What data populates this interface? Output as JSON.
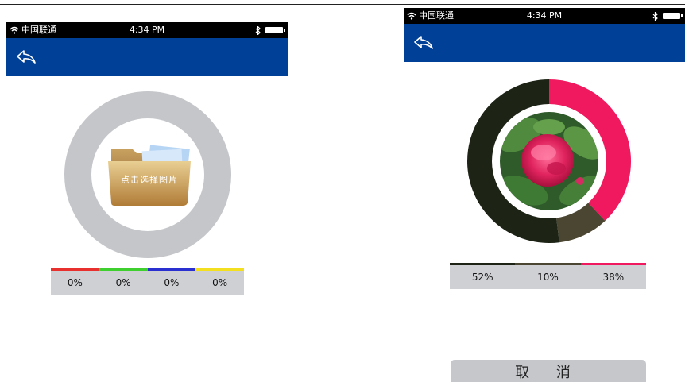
{
  "status_bar": {
    "carrier": "中国联通",
    "time": "4:34 PM"
  },
  "left_screen": {
    "folder_label": "点击选择图片",
    "color_strip": [
      {
        "color": "#e8312f",
        "value": "0%"
      },
      {
        "color": "#3fcf2f",
        "value": "0%"
      },
      {
        "color": "#2a2fd0",
        "value": "0%"
      },
      {
        "color": "#f3df20",
        "value": "0%"
      }
    ]
  },
  "right_screen": {
    "color_strip": [
      {
        "color": "#1d2416",
        "value": "52%"
      },
      {
        "color": "#4a4631",
        "value": "10%"
      },
      {
        "color": "#f0185e",
        "value": "38%"
      }
    ],
    "cancel_label": "取 消"
  },
  "colors": {
    "nav_blue": "#004097",
    "ring_gray": "#c5c6ca",
    "strip_gray": "#cfd0d4"
  }
}
